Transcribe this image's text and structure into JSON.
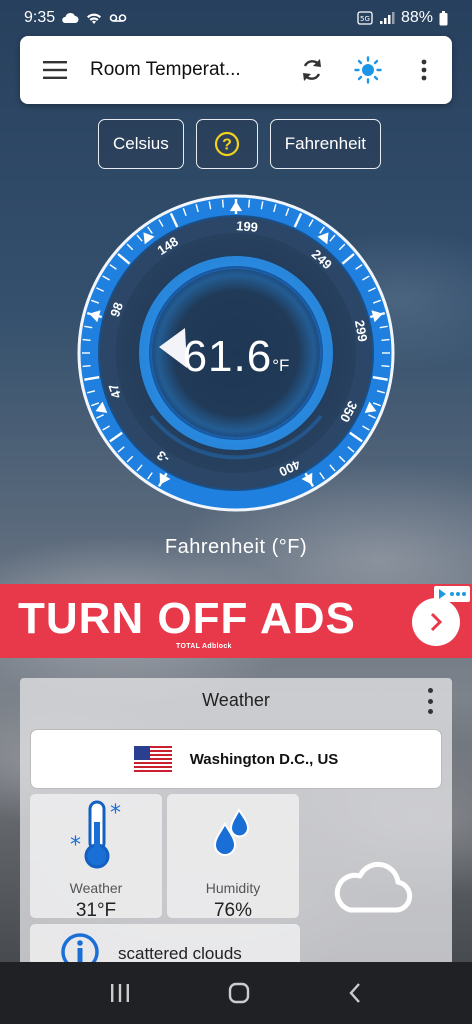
{
  "status": {
    "time": "9:35",
    "battery": "88%"
  },
  "toolbar": {
    "title": "Room Temperat..."
  },
  "units": {
    "celsius": "Celsius",
    "help": "?",
    "fahrenheit": "Fahrenheit"
  },
  "gauge": {
    "value": "61.6",
    "unit": "°F",
    "scale_label": "Fahrenheit  (°F)",
    "ticks": [
      "-3",
      "47",
      "98",
      "148",
      "199",
      "249",
      "299",
      "350",
      "400"
    ],
    "accent": "#2a8fe8"
  },
  "ad": {
    "headline": "TURN OFF ADS",
    "brand": "TOTAL Adblock",
    "color": "#e8394b"
  },
  "weather": {
    "title": "Weather",
    "location": "Washington D.C., US",
    "temp_label": "Weather",
    "temp_value": "31°F",
    "humidity_label": "Humidity",
    "humidity_value": "76%",
    "description": "scattered clouds"
  }
}
